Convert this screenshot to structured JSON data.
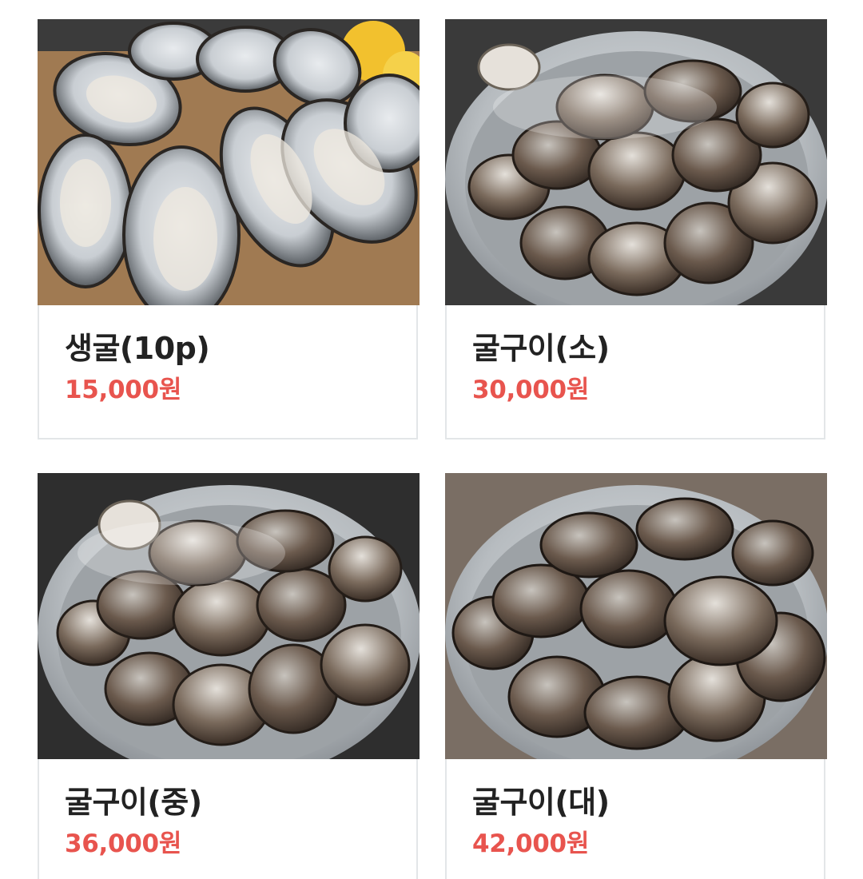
{
  "menu": {
    "items": [
      {
        "name": "생굴(10p)",
        "price": "15,000원",
        "photo": "raw-oysters-on-board"
      },
      {
        "name": "굴구이(소)",
        "price": "30,000원",
        "photo": "steamed-oysters-pot"
      },
      {
        "name": "굴구이(중)",
        "price": "36,000원",
        "photo": "steamed-oysters-pot"
      },
      {
        "name": "굴구이(대)",
        "price": "42,000원",
        "photo": "steamed-oysters-pot"
      }
    ]
  },
  "colors": {
    "price": "#e8544e",
    "name": "#222222",
    "card_border": "#e3e6e8"
  }
}
